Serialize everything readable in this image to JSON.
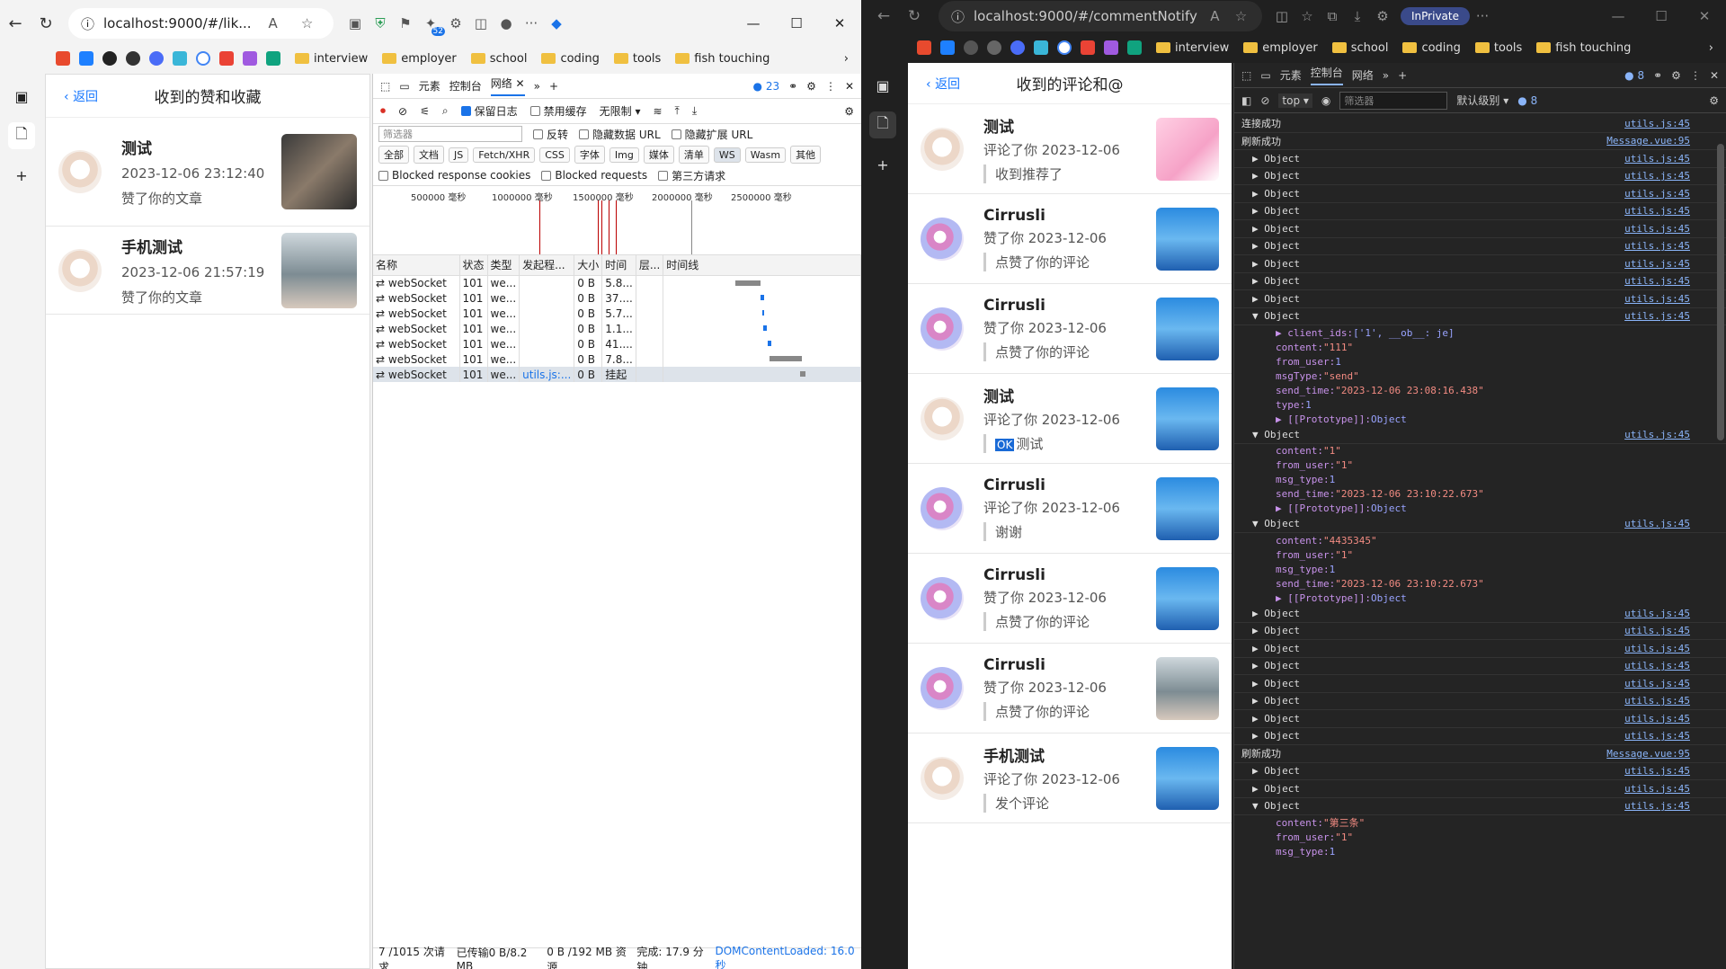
{
  "left_window": {
    "url": "localhost:9000/#/lik...",
    "ext_badge": "52",
    "bookmarks": [
      "interview",
      "employer",
      "school",
      "coding",
      "tools",
      "fish touching"
    ],
    "app": {
      "back": "返回",
      "title": "收到的赞和收藏",
      "items": [
        {
          "name": "测试",
          "time": "2023-12-06 23:12:40",
          "action": "赞了你的文章",
          "thumb": "thA"
        },
        {
          "name": "手机测试",
          "time": "2023-12-06 21:57:19",
          "action": "赞了你的文章",
          "thumb": "thB"
        }
      ]
    },
    "devtools": {
      "tabs": [
        "元素",
        "控制台",
        "网络"
      ],
      "active_tab": "网络",
      "issues": "23",
      "toolbar": {
        "preserve_log": "保留日志",
        "disable_cache": "禁用缓存",
        "throttle": "无限制"
      },
      "filter_placeholder": "筛选器",
      "filter_checks": [
        "反转",
        "隐藏数据 URL",
        "隐藏扩展 URL"
      ],
      "types": [
        "全部",
        "文档",
        "JS",
        "Fetch/XHR",
        "CSS",
        "字体",
        "Img",
        "媒体",
        "清单",
        "WS",
        "Wasm",
        "其他"
      ],
      "selected_type": "WS",
      "blocked": [
        "Blocked response cookies",
        "Blocked requests",
        "第三方请求"
      ],
      "overview_labels": [
        "500000 毫秒",
        "1000000 毫秒",
        "1500000 毫秒",
        "2000000 毫秒",
        "2500000 毫秒"
      ],
      "columns": [
        "名称",
        "状态",
        "类型",
        "发起程...",
        "大小",
        "时间",
        "层...",
        "时间线"
      ],
      "rows": [
        {
          "name": "webSocket",
          "status": "101",
          "type": "we...",
          "initiator": "",
          "size": "0 B",
          "time": "5.8..."
        },
        {
          "name": "webSocket",
          "status": "101",
          "type": "we...",
          "initiator": "",
          "size": "0 B",
          "time": "37...."
        },
        {
          "name": "webSocket",
          "status": "101",
          "type": "we...",
          "initiator": "",
          "size": "0 B",
          "time": "5.7..."
        },
        {
          "name": "webSocket",
          "status": "101",
          "type": "we...",
          "initiator": "",
          "size": "0 B",
          "time": "1.1..."
        },
        {
          "name": "webSocket",
          "status": "101",
          "type": "we...",
          "initiator": "",
          "size": "0 B",
          "time": "41...."
        },
        {
          "name": "webSocket",
          "status": "101",
          "type": "we...",
          "initiator": "",
          "size": "0 B",
          "time": "7.8..."
        },
        {
          "name": "webSocket",
          "status": "101",
          "type": "we...",
          "initiator": "utils.js:...",
          "size": "0 B",
          "time": "挂起"
        }
      ],
      "status_bar": {
        "requests": "7 /1015 次请求",
        "transferred": "已传输0 B/8.2 MB",
        "resources": "0 B /192 MB 资源",
        "finish": "完成: 17.9 分钟",
        "dcl": "DOMContentLoaded: 16.0 秒"
      }
    }
  },
  "right_window": {
    "url": "localhost:9000/#/commentNotify",
    "inprivate": "InPrivate",
    "bookmarks": [
      "interview",
      "employer",
      "school",
      "coding",
      "tools",
      "fish touching"
    ],
    "app": {
      "back": "返回",
      "title": "收到的评论和@",
      "items": [
        {
          "name": "测试",
          "meta": "评论了你 2023-12-06",
          "comment": "收到推荐了",
          "ok": false,
          "av": "av1",
          "thumb": "thC"
        },
        {
          "name": "Cirrusli",
          "meta": "赞了你 2023-12-06",
          "comment": "点赞了你的评论",
          "ok": false,
          "av": "av2",
          "thumb": "thD"
        },
        {
          "name": "Cirrusli",
          "meta": "赞了你 2023-12-06",
          "comment": "点赞了你的评论",
          "ok": false,
          "av": "av2",
          "thumb": "thD"
        },
        {
          "name": "测试",
          "meta": "评论了你 2023-12-06",
          "comment": "测试",
          "ok": true,
          "av": "av1",
          "thumb": "thD"
        },
        {
          "name": "Cirrusli",
          "meta": "评论了你 2023-12-06",
          "comment": "谢谢",
          "ok": false,
          "av": "av2",
          "thumb": "thD"
        },
        {
          "name": "Cirrusli",
          "meta": "赞了你 2023-12-06",
          "comment": "点赞了你的评论",
          "ok": false,
          "av": "av2",
          "thumb": "thD"
        },
        {
          "name": "Cirrusli",
          "meta": "赞了你 2023-12-06",
          "comment": "点赞了你的评论",
          "ok": false,
          "av": "av2",
          "thumb": "thB"
        },
        {
          "name": "手机测试",
          "meta": "评论了你 2023-12-06",
          "comment": "发个评论",
          "ok": false,
          "av": "av1",
          "thumb": "thD"
        }
      ],
      "ok_badge": "OK"
    },
    "devtools": {
      "tabs": [
        "元素",
        "控制台",
        "网络"
      ],
      "active_tab": "控制台",
      "issues": "8",
      "context": "top",
      "filter_placeholder": "筛选器",
      "level": "默认级别",
      "level_count": "8",
      "console": [
        {
          "kind": "msg",
          "text": "连接成功",
          "src": "utils.js:45"
        },
        {
          "kind": "msg",
          "text": "刷新成功",
          "src": "Message.vue:95"
        },
        {
          "kind": "obj",
          "text": "Object",
          "src": "utils.js:45"
        },
        {
          "kind": "obj",
          "text": "Object",
          "src": "utils.js:45"
        },
        {
          "kind": "obj",
          "text": "Object",
          "src": "utils.js:45"
        },
        {
          "kind": "obj",
          "text": "Object",
          "src": "utils.js:45"
        },
        {
          "kind": "obj",
          "text": "Object",
          "src": "utils.js:45"
        },
        {
          "kind": "obj",
          "text": "Object",
          "src": "utils.js:45"
        },
        {
          "kind": "obj",
          "text": "Object",
          "src": "utils.js:45"
        },
        {
          "kind": "obj",
          "text": "Object",
          "src": "utils.js:45"
        },
        {
          "kind": "obj",
          "text": "Object",
          "src": "utils.js:45"
        },
        {
          "kind": "open",
          "text": "Object",
          "src": "utils.js:45",
          "props": [
            "▶ client_ids: ['1', __ob__: je]",
            "content: \"111\"",
            "from_user: 1",
            "msgType: \"send\"",
            "send_time: \"2023-12-06 23:08:16.438\"",
            "type: 1",
            "▶ [[Prototype]]: Object"
          ]
        },
        {
          "kind": "open",
          "text": "Object",
          "src": "utils.js:45",
          "props": [
            "content: \"1\"",
            "from_user: \"1\"",
            "msg_type: 1",
            "send_time: \"2023-12-06 23:10:22.673\"",
            "▶ [[Prototype]]: Object"
          ]
        },
        {
          "kind": "open",
          "text": "Object",
          "src": "utils.js:45",
          "props": [
            "content: \"4435345\"",
            "from_user: \"1\"",
            "msg_type: 1",
            "send_time: \"2023-12-06 23:10:22.673\"",
            "▶ [[Prototype]]: Object"
          ]
        },
        {
          "kind": "obj",
          "text": "Object",
          "src": "utils.js:45"
        },
        {
          "kind": "obj",
          "text": "Object",
          "src": "utils.js:45"
        },
        {
          "kind": "obj",
          "text": "Object",
          "src": "utils.js:45"
        },
        {
          "kind": "obj",
          "text": "Object",
          "src": "utils.js:45"
        },
        {
          "kind": "obj",
          "text": "Object",
          "src": "utils.js:45"
        },
        {
          "kind": "obj",
          "text": "Object",
          "src": "utils.js:45"
        },
        {
          "kind": "obj",
          "text": "Object",
          "src": "utils.js:45"
        },
        {
          "kind": "obj",
          "text": "Object",
          "src": "utils.js:45"
        },
        {
          "kind": "msg",
          "text": "刷新成功",
          "src": "Message.vue:95"
        },
        {
          "kind": "obj",
          "text": "Object",
          "src": "utils.js:45"
        },
        {
          "kind": "obj",
          "text": "Object",
          "src": "utils.js:45"
        },
        {
          "kind": "open",
          "text": "Object",
          "src": "utils.js:45",
          "props": [
            "content: \"第三条\"",
            "from_user: \"1\"",
            "msg_type: 1"
          ]
        }
      ]
    }
  }
}
